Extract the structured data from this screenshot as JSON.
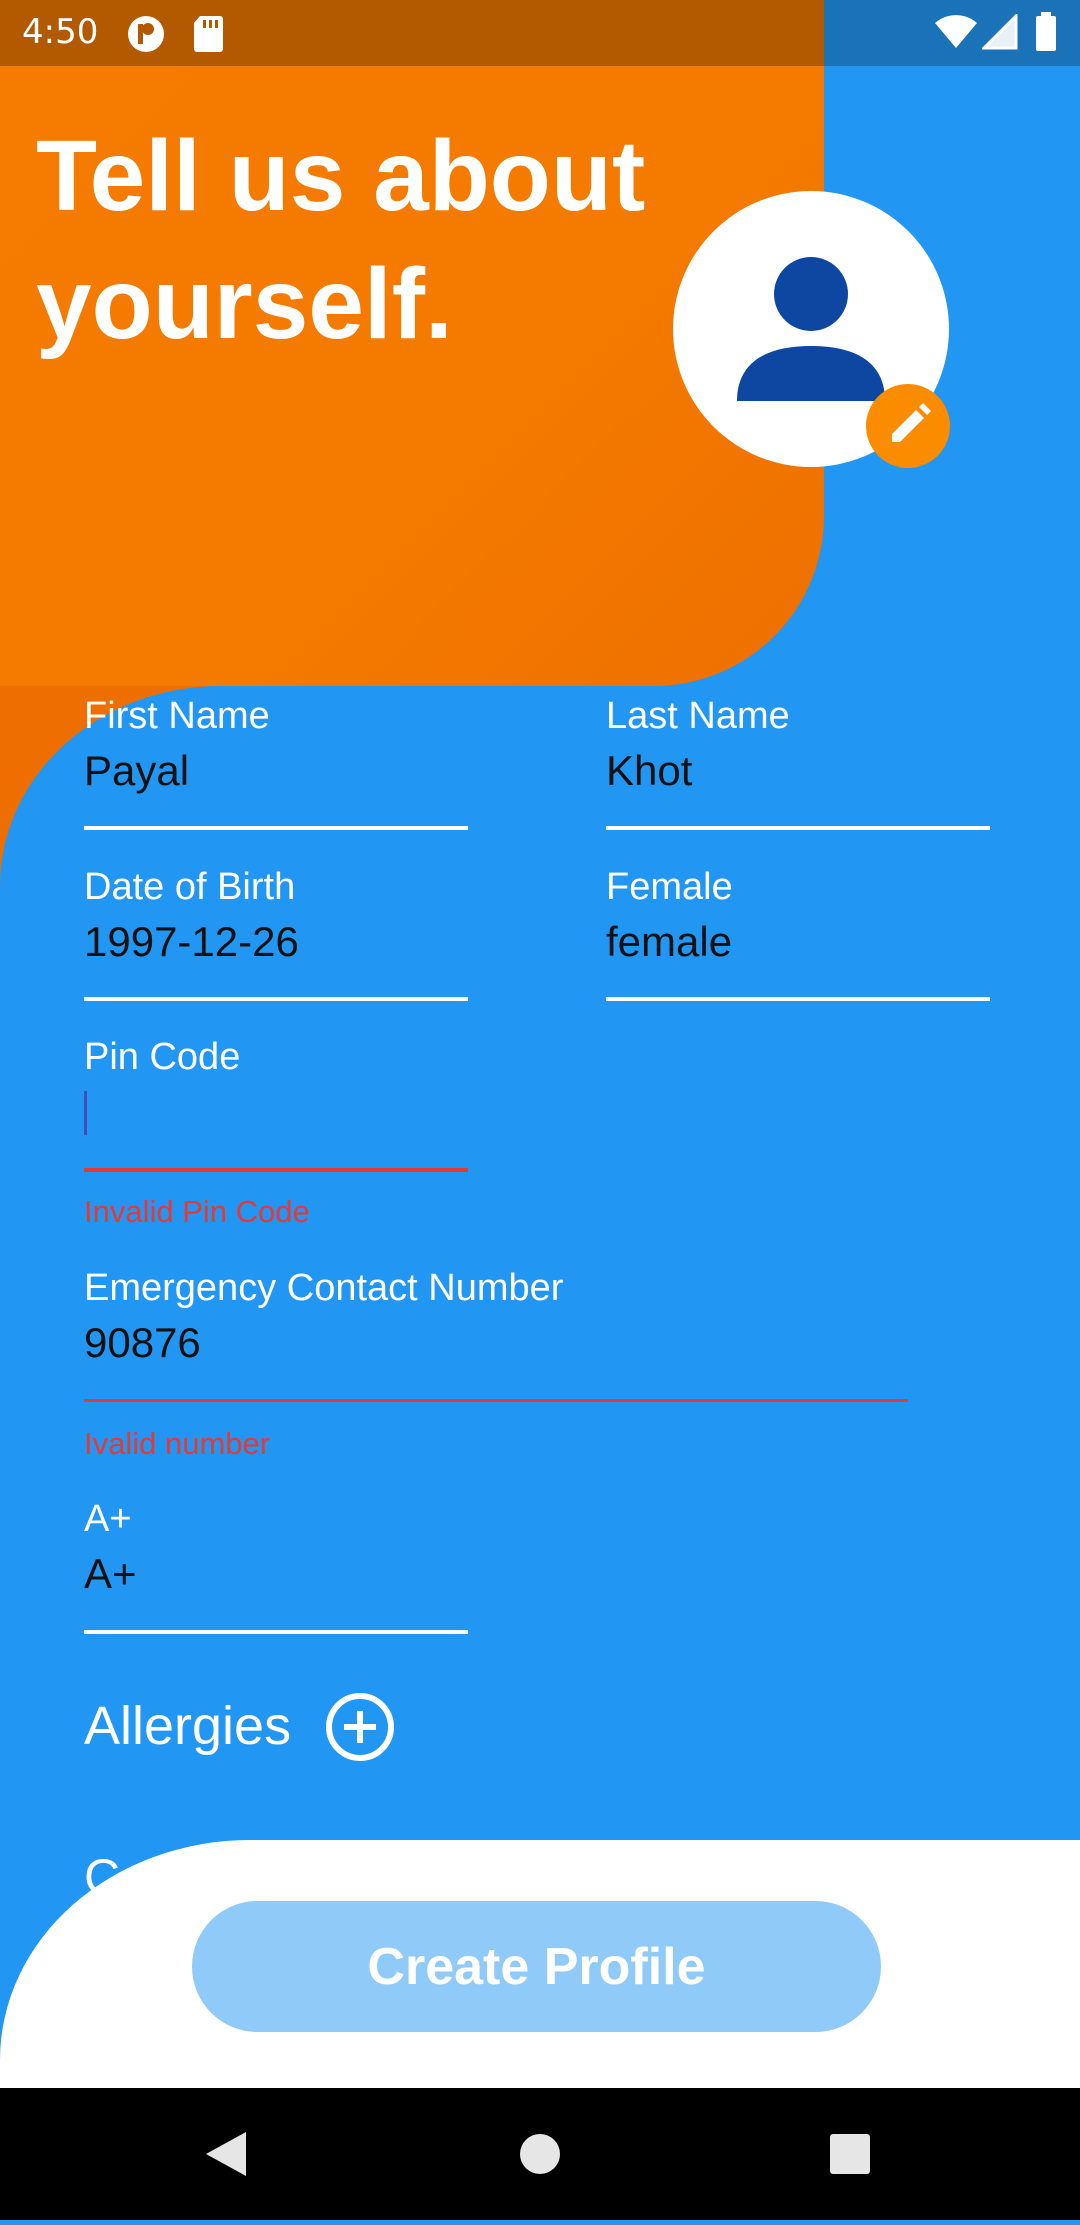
{
  "status_bar": {
    "time": "4:50",
    "left_icons": [
      "notification-app-icon",
      "sd-card-icon"
    ],
    "right_icons": [
      "wifi-icon",
      "cell-signal-icon",
      "battery-icon"
    ]
  },
  "header": {
    "title": "Tell us about yourself."
  },
  "avatar": {
    "icon": "person-icon",
    "badge_icon": "pencil-icon"
  },
  "form": {
    "first_name": {
      "label": "First Name",
      "value": "Payal"
    },
    "last_name": {
      "label": "Last Name",
      "value": "Khot"
    },
    "dob": {
      "label": "Date of Birth",
      "value": "1997-12-26"
    },
    "gender": {
      "label": "Female",
      "value": "female"
    },
    "pin_code": {
      "label": "Pin Code",
      "value": "",
      "error": "Invalid Pin Code"
    },
    "emergency_contact": {
      "label": "Emergency Contact Number",
      "value": "90876",
      "error": "Ivalid number"
    },
    "blood_group": {
      "label": "A+",
      "value": "A+"
    },
    "allergies": {
      "label": "Allergies",
      "icon": "add-circle-icon"
    },
    "peek_text": "C"
  },
  "actions": {
    "create_profile": "Create Profile"
  },
  "colors": {
    "primary": "#2196F3",
    "accent": "#F57C00",
    "error": "#E53935",
    "button_disabled": "#90CAF9"
  },
  "nav_bar": {
    "icons": [
      "back-icon",
      "home-icon",
      "recents-icon"
    ]
  }
}
